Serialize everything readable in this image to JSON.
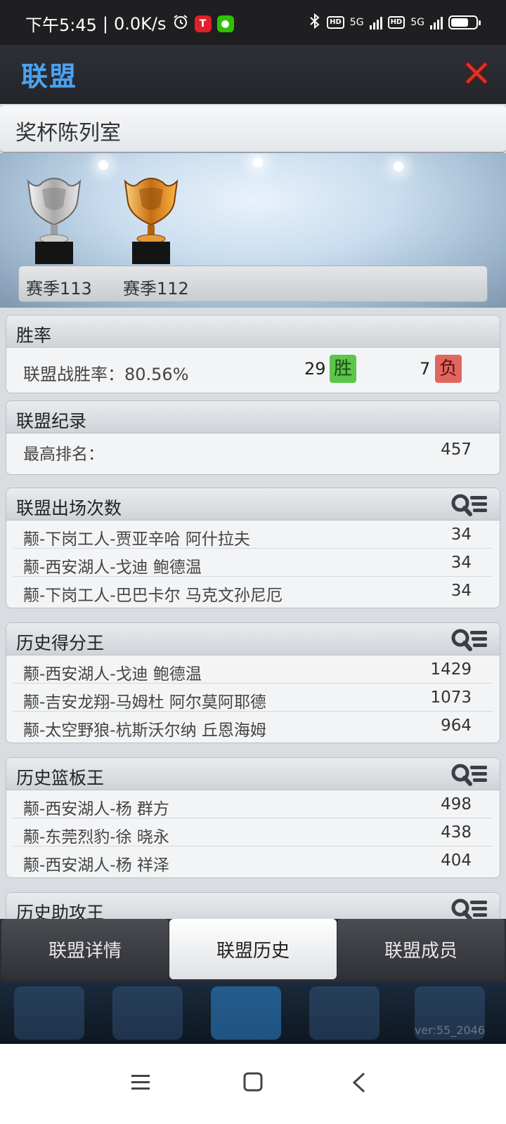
{
  "status_bar": {
    "time": "下午5:45",
    "speed": "0.0K/s",
    "net1": "5G",
    "net2": "5G",
    "battery_level": 0.7
  },
  "header": {
    "title": "联盟"
  },
  "trophy_room": {
    "title": "奖杯陈列室",
    "trophies": [
      {
        "label": "赛季113",
        "kind": "silver"
      },
      {
        "label": "赛季112",
        "kind": "gold"
      }
    ]
  },
  "win_rate": {
    "title": "胜率",
    "label": "联盟战胜率：80.56%",
    "wins": "29",
    "win_badge": "胜",
    "losses": "7",
    "lose_badge": "负"
  },
  "record": {
    "title": "联盟纪录",
    "label": "最高排名：",
    "value": "457"
  },
  "appearances": {
    "title": "联盟出场次数",
    "rows": [
      {
        "name": "颟-下岗工人-贾亚辛哈 阿什拉夫",
        "value": "34"
      },
      {
        "name": "颟-西安湖人-戈迪 鲍德温",
        "value": "34"
      },
      {
        "name": "颟-下岗工人-巴巴卡尔 马克文孙尼厄",
        "value": "34"
      }
    ]
  },
  "scoring": {
    "title": "历史得分王",
    "rows": [
      {
        "name": "颟-西安湖人-戈迪 鲍德温",
        "value": "1429"
      },
      {
        "name": "颟-吉安龙翔-马姆杜 阿尔莫阿耶德",
        "value": "1073"
      },
      {
        "name": "颟-太空野狼-杭斯沃尔纳 丘恩海姆",
        "value": "964"
      }
    ]
  },
  "rebounds": {
    "title": "历史篮板王",
    "rows": [
      {
        "name": "颟-西安湖人-杨 群方",
        "value": "498"
      },
      {
        "name": "颟-东莞烈豹-徐 晓永",
        "value": "438"
      },
      {
        "name": "颟-西安湖人-杨 祥泽",
        "value": "404"
      }
    ]
  },
  "assists": {
    "title": "历史助攻王"
  },
  "tabs": [
    {
      "label": "联盟详情",
      "active": false
    },
    {
      "label": "联盟历史",
      "active": true
    },
    {
      "label": "联盟成员",
      "active": false
    }
  ],
  "version": "ver:55_2046",
  "icons": {
    "close": "close-icon",
    "list": "list-search-icon",
    "nav_menu": "menu-icon",
    "nav_home": "home-icon",
    "nav_back": "back-icon"
  }
}
